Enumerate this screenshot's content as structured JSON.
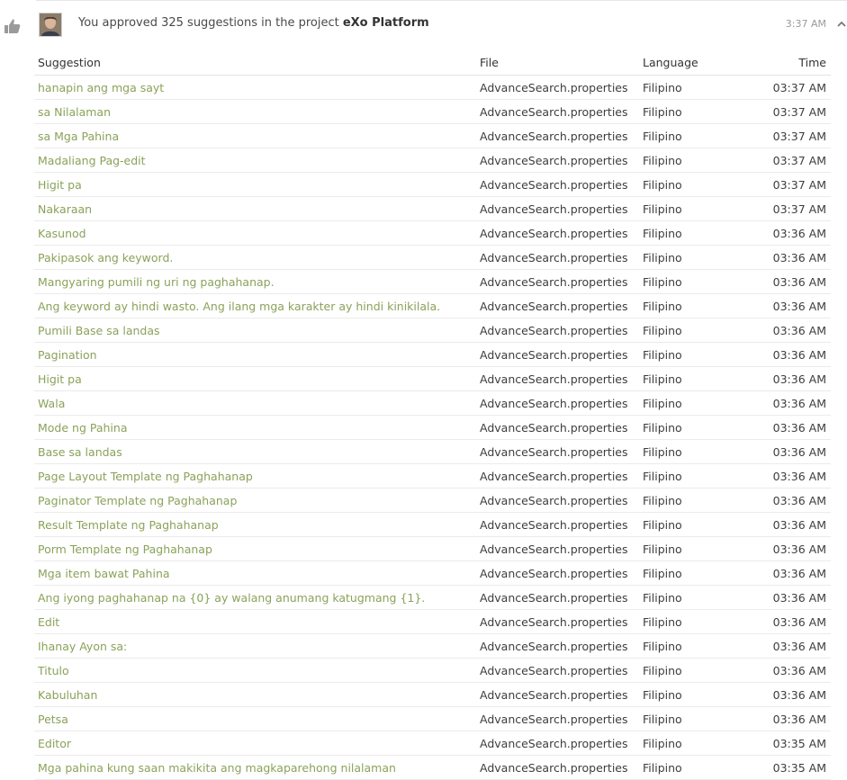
{
  "notification": {
    "text_prefix": "You approved 325 suggestions in the project ",
    "project": "eXo Platform",
    "time": "3:37 AM"
  },
  "table": {
    "headers": {
      "suggestion": "Suggestion",
      "file": "File",
      "language": "Language",
      "time": "Time"
    },
    "rows": [
      {
        "suggestion": "hanapin ang mga sayt",
        "file": "AdvanceSearch.properties",
        "language": "Filipino",
        "time": "03:37 AM"
      },
      {
        "suggestion": "sa Nilalaman",
        "file": "AdvanceSearch.properties",
        "language": "Filipino",
        "time": "03:37 AM"
      },
      {
        "suggestion": "sa Mga Pahina",
        "file": "AdvanceSearch.properties",
        "language": "Filipino",
        "time": "03:37 AM"
      },
      {
        "suggestion": "Madaliang Pag-edit",
        "file": "AdvanceSearch.properties",
        "language": "Filipino",
        "time": "03:37 AM"
      },
      {
        "suggestion": "Higit pa",
        "file": "AdvanceSearch.properties",
        "language": "Filipino",
        "time": "03:37 AM"
      },
      {
        "suggestion": "Nakaraan",
        "file": "AdvanceSearch.properties",
        "language": "Filipino",
        "time": "03:37 AM"
      },
      {
        "suggestion": "Kasunod",
        "file": "AdvanceSearch.properties",
        "language": "Filipino",
        "time": "03:36 AM"
      },
      {
        "suggestion": "Pakipasok ang keyword.",
        "file": "AdvanceSearch.properties",
        "language": "Filipino",
        "time": "03:36 AM"
      },
      {
        "suggestion": "Mangyaring pumili ng uri ng paghahanap.",
        "file": "AdvanceSearch.properties",
        "language": "Filipino",
        "time": "03:36 AM"
      },
      {
        "suggestion": "Ang keyword ay hindi wasto. Ang ilang mga karakter ay hindi kinikilala.",
        "file": "AdvanceSearch.properties",
        "language": "Filipino",
        "time": "03:36 AM"
      },
      {
        "suggestion": "Pumili Base sa landas",
        "file": "AdvanceSearch.properties",
        "language": "Filipino",
        "time": "03:36 AM"
      },
      {
        "suggestion": "Pagination",
        "file": "AdvanceSearch.properties",
        "language": "Filipino",
        "time": "03:36 AM"
      },
      {
        "suggestion": "Higit pa",
        "file": "AdvanceSearch.properties",
        "language": "Filipino",
        "time": "03:36 AM"
      },
      {
        "suggestion": "Wala",
        "file": "AdvanceSearch.properties",
        "language": "Filipino",
        "time": "03:36 AM"
      },
      {
        "suggestion": "Mode ng Pahina",
        "file": "AdvanceSearch.properties",
        "language": "Filipino",
        "time": "03:36 AM"
      },
      {
        "suggestion": "Base sa landas",
        "file": "AdvanceSearch.properties",
        "language": "Filipino",
        "time": "03:36 AM"
      },
      {
        "suggestion": "Page Layout Template ng Paghahanap",
        "file": "AdvanceSearch.properties",
        "language": "Filipino",
        "time": "03:36 AM"
      },
      {
        "suggestion": "Paginator Template ng Paghahanap",
        "file": "AdvanceSearch.properties",
        "language": "Filipino",
        "time": "03:36 AM"
      },
      {
        "suggestion": "Result Template ng Paghahanap",
        "file": "AdvanceSearch.properties",
        "language": "Filipino",
        "time": "03:36 AM"
      },
      {
        "suggestion": "Porm Template ng Paghahanap",
        "file": "AdvanceSearch.properties",
        "language": "Filipino",
        "time": "03:36 AM"
      },
      {
        "suggestion": "Mga item bawat Pahina",
        "file": "AdvanceSearch.properties",
        "language": "Filipino",
        "time": "03:36 AM"
      },
      {
        "suggestion": "Ang iyong paghahanap na {0} ay walang anumang katugmang {1}.",
        "file": "AdvanceSearch.properties",
        "language": "Filipino",
        "time": "03:36 AM"
      },
      {
        "suggestion": "Edit",
        "file": "AdvanceSearch.properties",
        "language": "Filipino",
        "time": "03:36 AM"
      },
      {
        "suggestion": "Ihanay Ayon sa:",
        "file": "AdvanceSearch.properties",
        "language": "Filipino",
        "time": "03:36 AM"
      },
      {
        "suggestion": "Titulo",
        "file": "AdvanceSearch.properties",
        "language": "Filipino",
        "time": "03:36 AM"
      },
      {
        "suggestion": "Kabuluhan",
        "file": "AdvanceSearch.properties",
        "language": "Filipino",
        "time": "03:36 AM"
      },
      {
        "suggestion": "Petsa",
        "file": "AdvanceSearch.properties",
        "language": "Filipino",
        "time": "03:36 AM"
      },
      {
        "suggestion": "Editor",
        "file": "AdvanceSearch.properties",
        "language": "Filipino",
        "time": "03:35 AM"
      },
      {
        "suggestion": "Mga pahina kung saan makikita ang magkaparehong nilalaman",
        "file": "AdvanceSearch.properties",
        "language": "Filipino",
        "time": "03:35 AM"
      }
    ]
  },
  "icons": {
    "activity": "thumbs-up-icon",
    "collapse": "chevron-up-icon"
  },
  "colors": {
    "suggestion_link": "#8aa25a",
    "muted": "#9a9a9a"
  }
}
